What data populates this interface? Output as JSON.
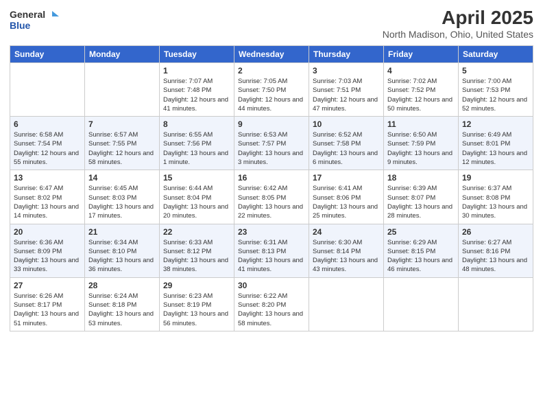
{
  "logo": {
    "general": "General",
    "blue": "Blue"
  },
  "header": {
    "title": "April 2025",
    "subtitle": "North Madison, Ohio, United States"
  },
  "weekdays": [
    "Sunday",
    "Monday",
    "Tuesday",
    "Wednesday",
    "Thursday",
    "Friday",
    "Saturday"
  ],
  "weeks": [
    [
      {
        "day": "",
        "sunrise": "",
        "sunset": "",
        "daylight": ""
      },
      {
        "day": "",
        "sunrise": "",
        "sunset": "",
        "daylight": ""
      },
      {
        "day": "1",
        "sunrise": "Sunrise: 7:07 AM",
        "sunset": "Sunset: 7:48 PM",
        "daylight": "Daylight: 12 hours and 41 minutes."
      },
      {
        "day": "2",
        "sunrise": "Sunrise: 7:05 AM",
        "sunset": "Sunset: 7:50 PM",
        "daylight": "Daylight: 12 hours and 44 minutes."
      },
      {
        "day": "3",
        "sunrise": "Sunrise: 7:03 AM",
        "sunset": "Sunset: 7:51 PM",
        "daylight": "Daylight: 12 hours and 47 minutes."
      },
      {
        "day": "4",
        "sunrise": "Sunrise: 7:02 AM",
        "sunset": "Sunset: 7:52 PM",
        "daylight": "Daylight: 12 hours and 50 minutes."
      },
      {
        "day": "5",
        "sunrise": "Sunrise: 7:00 AM",
        "sunset": "Sunset: 7:53 PM",
        "daylight": "Daylight: 12 hours and 52 minutes."
      }
    ],
    [
      {
        "day": "6",
        "sunrise": "Sunrise: 6:58 AM",
        "sunset": "Sunset: 7:54 PM",
        "daylight": "Daylight: 12 hours and 55 minutes."
      },
      {
        "day": "7",
        "sunrise": "Sunrise: 6:57 AM",
        "sunset": "Sunset: 7:55 PM",
        "daylight": "Daylight: 12 hours and 58 minutes."
      },
      {
        "day": "8",
        "sunrise": "Sunrise: 6:55 AM",
        "sunset": "Sunset: 7:56 PM",
        "daylight": "Daylight: 13 hours and 1 minute."
      },
      {
        "day": "9",
        "sunrise": "Sunrise: 6:53 AM",
        "sunset": "Sunset: 7:57 PM",
        "daylight": "Daylight: 13 hours and 3 minutes."
      },
      {
        "day": "10",
        "sunrise": "Sunrise: 6:52 AM",
        "sunset": "Sunset: 7:58 PM",
        "daylight": "Daylight: 13 hours and 6 minutes."
      },
      {
        "day": "11",
        "sunrise": "Sunrise: 6:50 AM",
        "sunset": "Sunset: 7:59 PM",
        "daylight": "Daylight: 13 hours and 9 minutes."
      },
      {
        "day": "12",
        "sunrise": "Sunrise: 6:49 AM",
        "sunset": "Sunset: 8:01 PM",
        "daylight": "Daylight: 13 hours and 12 minutes."
      }
    ],
    [
      {
        "day": "13",
        "sunrise": "Sunrise: 6:47 AM",
        "sunset": "Sunset: 8:02 PM",
        "daylight": "Daylight: 13 hours and 14 minutes."
      },
      {
        "day": "14",
        "sunrise": "Sunrise: 6:45 AM",
        "sunset": "Sunset: 8:03 PM",
        "daylight": "Daylight: 13 hours and 17 minutes."
      },
      {
        "day": "15",
        "sunrise": "Sunrise: 6:44 AM",
        "sunset": "Sunset: 8:04 PM",
        "daylight": "Daylight: 13 hours and 20 minutes."
      },
      {
        "day": "16",
        "sunrise": "Sunrise: 6:42 AM",
        "sunset": "Sunset: 8:05 PM",
        "daylight": "Daylight: 13 hours and 22 minutes."
      },
      {
        "day": "17",
        "sunrise": "Sunrise: 6:41 AM",
        "sunset": "Sunset: 8:06 PM",
        "daylight": "Daylight: 13 hours and 25 minutes."
      },
      {
        "day": "18",
        "sunrise": "Sunrise: 6:39 AM",
        "sunset": "Sunset: 8:07 PM",
        "daylight": "Daylight: 13 hours and 28 minutes."
      },
      {
        "day": "19",
        "sunrise": "Sunrise: 6:37 AM",
        "sunset": "Sunset: 8:08 PM",
        "daylight": "Daylight: 13 hours and 30 minutes."
      }
    ],
    [
      {
        "day": "20",
        "sunrise": "Sunrise: 6:36 AM",
        "sunset": "Sunset: 8:09 PM",
        "daylight": "Daylight: 13 hours and 33 minutes."
      },
      {
        "day": "21",
        "sunrise": "Sunrise: 6:34 AM",
        "sunset": "Sunset: 8:10 PM",
        "daylight": "Daylight: 13 hours and 36 minutes."
      },
      {
        "day": "22",
        "sunrise": "Sunrise: 6:33 AM",
        "sunset": "Sunset: 8:12 PM",
        "daylight": "Daylight: 13 hours and 38 minutes."
      },
      {
        "day": "23",
        "sunrise": "Sunrise: 6:31 AM",
        "sunset": "Sunset: 8:13 PM",
        "daylight": "Daylight: 13 hours and 41 minutes."
      },
      {
        "day": "24",
        "sunrise": "Sunrise: 6:30 AM",
        "sunset": "Sunset: 8:14 PM",
        "daylight": "Daylight: 13 hours and 43 minutes."
      },
      {
        "day": "25",
        "sunrise": "Sunrise: 6:29 AM",
        "sunset": "Sunset: 8:15 PM",
        "daylight": "Daylight: 13 hours and 46 minutes."
      },
      {
        "day": "26",
        "sunrise": "Sunrise: 6:27 AM",
        "sunset": "Sunset: 8:16 PM",
        "daylight": "Daylight: 13 hours and 48 minutes."
      }
    ],
    [
      {
        "day": "27",
        "sunrise": "Sunrise: 6:26 AM",
        "sunset": "Sunset: 8:17 PM",
        "daylight": "Daylight: 13 hours and 51 minutes."
      },
      {
        "day": "28",
        "sunrise": "Sunrise: 6:24 AM",
        "sunset": "Sunset: 8:18 PM",
        "daylight": "Daylight: 13 hours and 53 minutes."
      },
      {
        "day": "29",
        "sunrise": "Sunrise: 6:23 AM",
        "sunset": "Sunset: 8:19 PM",
        "daylight": "Daylight: 13 hours and 56 minutes."
      },
      {
        "day": "30",
        "sunrise": "Sunrise: 6:22 AM",
        "sunset": "Sunset: 8:20 PM",
        "daylight": "Daylight: 13 hours and 58 minutes."
      },
      {
        "day": "",
        "sunrise": "",
        "sunset": "",
        "daylight": ""
      },
      {
        "day": "",
        "sunrise": "",
        "sunset": "",
        "daylight": ""
      },
      {
        "day": "",
        "sunrise": "",
        "sunset": "",
        "daylight": ""
      }
    ]
  ]
}
